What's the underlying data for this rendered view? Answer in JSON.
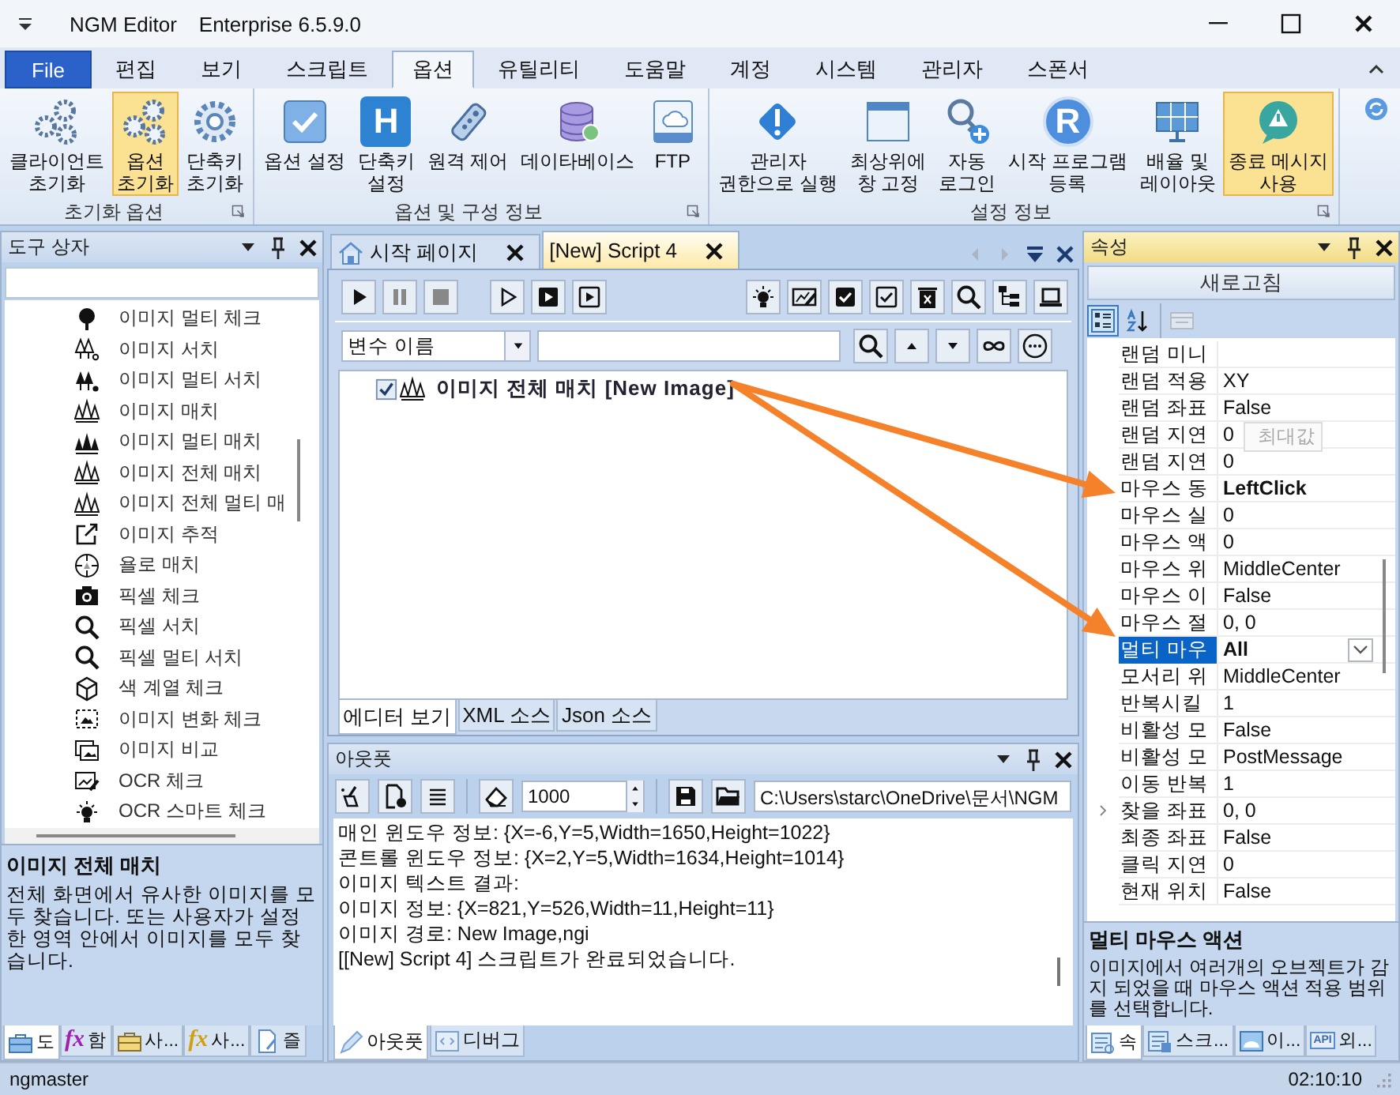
{
  "window": {
    "title": "NGM Editor",
    "edition": "Enterprise 6.5.9.0"
  },
  "menu_tabs": [
    {
      "label": "File",
      "kind": "file",
      "selected": false
    },
    {
      "label": "편집",
      "kind": "tab",
      "selected": false
    },
    {
      "label": "보기",
      "kind": "tab",
      "selected": false
    },
    {
      "label": "스크립트",
      "kind": "tab",
      "selected": false
    },
    {
      "label": "옵션",
      "kind": "tab",
      "selected": true
    },
    {
      "label": "유틸리티",
      "kind": "tab",
      "selected": false
    },
    {
      "label": "도움말",
      "kind": "tab",
      "selected": false
    },
    {
      "label": "계정",
      "kind": "tab",
      "selected": false
    },
    {
      "label": "시스템",
      "kind": "tab",
      "selected": false
    },
    {
      "label": "관리자",
      "kind": "tab",
      "selected": false
    },
    {
      "label": "스폰서",
      "kind": "tab",
      "selected": false
    }
  ],
  "ribbon_groups": [
    {
      "label": "초기화 옵션",
      "buttons": [
        {
          "label": "클라이언트\n초기화",
          "highlighted": false
        },
        {
          "label": "옵션\n초기화",
          "highlighted": true
        },
        {
          "label": "단축키\n초기화",
          "highlighted": false
        }
      ]
    },
    {
      "label": "옵션 및 구성 정보",
      "buttons": [
        {
          "label": "옵션 설정",
          "highlighted": false
        },
        {
          "label": "단축키\n설정",
          "icon_text": "H",
          "highlighted": false
        },
        {
          "label": "원격 제어",
          "highlighted": false
        },
        {
          "label": "데이타베이스",
          "highlighted": false
        },
        {
          "label": "FTP",
          "highlighted": false
        }
      ]
    },
    {
      "label": "설정 정보",
      "buttons": [
        {
          "label": "관리자\n권한으로 실행",
          "highlighted": false
        },
        {
          "label": "최상위에\n창 고정",
          "highlighted": false
        },
        {
          "label": "자동\n로그인",
          "highlighted": false
        },
        {
          "label": "시작 프로그램\n등록",
          "icon_text": "R",
          "highlighted": false
        },
        {
          "label": "배율 및\n레이아웃",
          "highlighted": false
        },
        {
          "label": "종료 메시지\n사용",
          "highlighted": true
        }
      ]
    }
  ],
  "toolbox": {
    "title": "도구 상자",
    "items": [
      "이미지 멀티 체크",
      "이미지 서치",
      "이미지 멀티 서치",
      "이미지 매치",
      "이미지 멀티 매치",
      "이미지 전체 매치",
      "이미지 전체 멀티 매",
      "이미지 추적",
      "욜로 매치",
      "픽셀 체크",
      "픽셀 서치",
      "픽셀 멀티 서치",
      "색 계열 체크",
      "이미지 변화 체크",
      "이미지 비교",
      "OCR 체크",
      "OCR 스마트 체크"
    ],
    "description": {
      "title": "이미지 전체 매치",
      "text": "전체 화면에서 유사한 이미지를 모두 찾습니다. 또는 사용자가 설정한 영역 안에서 이미지를 모두 찾습니다."
    },
    "tabs": [
      {
        "label": "도",
        "selected": true
      },
      {
        "label": "함",
        "icon_text": "fx",
        "selected": false
      },
      {
        "label": "사...",
        "selected": false
      },
      {
        "label": "사...",
        "icon_text": "fx",
        "selected": false
      },
      {
        "label": "즐",
        "selected": false
      }
    ]
  },
  "document_tabs": [
    {
      "label": "시작 페이지",
      "selected": false
    },
    {
      "label": "[New] Script 4",
      "selected": true
    }
  ],
  "editor": {
    "variable_select": "변수 이름",
    "nodes": [
      {
        "text": "이미지 전체 매치 [New Image]",
        "checked": true
      }
    ],
    "view_tabs": [
      {
        "label": "에디터 보기",
        "selected": true
      },
      {
        "label": "XML 소스",
        "selected": false
      },
      {
        "label": "Json 소스",
        "selected": false
      }
    ]
  },
  "output": {
    "title": "아웃풋",
    "count": "1000",
    "path": "C:\\Users\\starc\\OneDrive\\문서\\NGM",
    "lines": [
      "매인 윈도우 정보: {X=-6,Y=5,Width=1650,Height=1022}",
      "콘트롤 윈도우 정보: {X=2,Y=5,Width=1634,Height=1014}",
      "이미지 텍스트 결과:",
      "이미지 정보: {X=821,Y=526,Width=11,Height=11}",
      "이미지 경로: New Image,ngi",
      "[[New] Script 4] 스크립트가 완료되었습니다."
    ],
    "tabs": [
      {
        "label": "아웃풋",
        "selected": true
      },
      {
        "label": "디버그",
        "selected": false
      }
    ]
  },
  "properties": {
    "title": "속성",
    "refresh": "새로고침",
    "view_buttons": [
      {
        "selected": true
      },
      {
        "selected": false
      }
    ],
    "rows": [
      {
        "name": "랜덤 미니",
        "value": "",
        "selected": false
      },
      {
        "name": "랜덤 적용",
        "value": "XY",
        "bold": false,
        "selected": false
      },
      {
        "name": "랜덤 좌표",
        "value": "False",
        "bold": false,
        "selected": false
      },
      {
        "name": "랜덤 지연",
        "value": "0",
        "tooltip": "최대값",
        "bold": false,
        "selected": false
      },
      {
        "name": "랜덤 지연",
        "value": "0",
        "bold": false,
        "selected": false
      },
      {
        "name": "마우스 동",
        "value": "LeftClick",
        "bold": true,
        "selected": false
      },
      {
        "name": "마우스 실",
        "value": "0",
        "bold": false,
        "selected": false
      },
      {
        "name": "마우스 액",
        "value": "0",
        "bold": false,
        "selected": false
      },
      {
        "name": "마우스 위",
        "value": "MiddleCenter",
        "bold": false,
        "selected": false
      },
      {
        "name": "마우스 이",
        "value": "False",
        "bold": false,
        "selected": false
      },
      {
        "name": "마우스 절",
        "value": "0, 0",
        "bold": false,
        "selected": false
      },
      {
        "name": "멀티 마우",
        "value": "All",
        "bold": true,
        "selected": true
      },
      {
        "name": "모서리 위",
        "value": "MiddleCenter",
        "bold": false,
        "selected": false
      },
      {
        "name": "반복시킬",
        "value": "1",
        "bold": false,
        "selected": false
      },
      {
        "name": "비활성 모",
        "value": "False",
        "bold": false,
        "selected": false
      },
      {
        "name": "비활성 모",
        "value": "PostMessage",
        "bold": false,
        "selected": false
      },
      {
        "name": "이동 반복",
        "value": "1",
        "bold": false,
        "selected": false
      },
      {
        "name": "찾을 좌표",
        "value": "0, 0",
        "bold": false,
        "selected": false,
        "expanded": false
      },
      {
        "name": "최종 좌표",
        "value": "False",
        "bold": false,
        "selected": false
      },
      {
        "name": "클릭 지연",
        "value": "0",
        "bold": false,
        "selected": false
      },
      {
        "name": "현재 위치",
        "value": "False",
        "bold": false,
        "selected": false
      }
    ],
    "description": {
      "title": "멀티 마우스 액션",
      "text": "이미지에서 여러개의 오브젝트가 감지 되었을 때 마우스 액션 적용 범위를 선택합니다."
    },
    "tabs": [
      {
        "label": "속",
        "selected": true
      },
      {
        "label": "스크...",
        "selected": false
      },
      {
        "label": "이...",
        "selected": false
      },
      {
        "label": "외...",
        "icon_text": "API",
        "selected": false
      }
    ]
  },
  "status_bar": {
    "user": "ngmaster",
    "time": "02:10:10"
  }
}
